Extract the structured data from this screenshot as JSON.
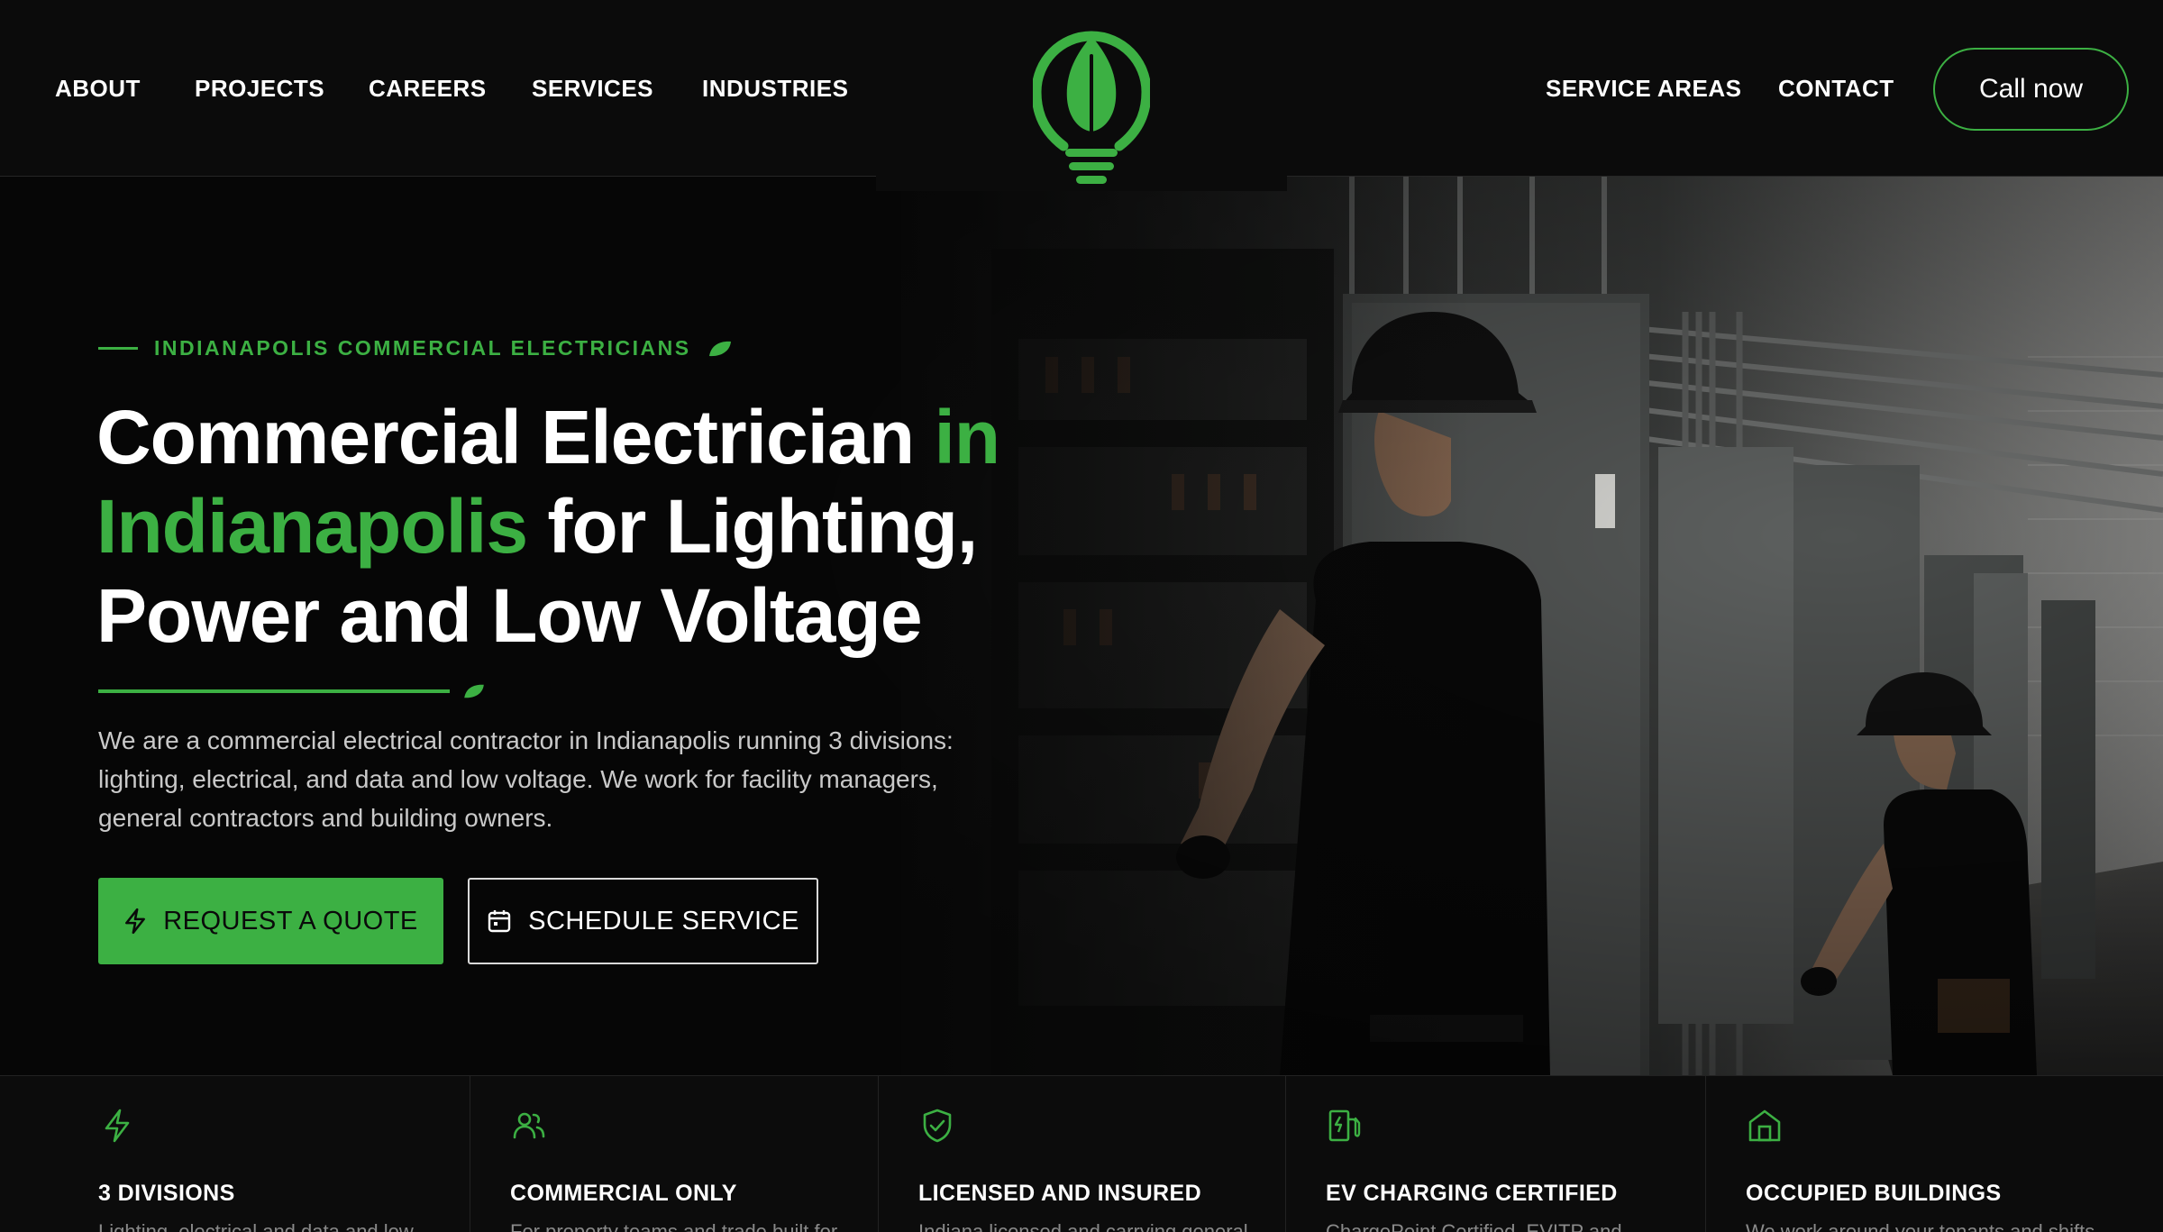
{
  "nav": {
    "left": [
      "ABOUT",
      "PROJECTS",
      "CAREERS",
      "SERVICES",
      "INDUSTRIES"
    ],
    "right": [
      "SERVICE AREAS",
      "CONTACT"
    ],
    "call_label": "Call now"
  },
  "hero": {
    "eyebrow": "INDIANAPOLIS COMMERCIAL ELECTRICIANS",
    "headline": {
      "part1": "Commercial Electrician ",
      "part2_green": "in Indianapolis",
      "part3": " for Lighting, Power and Low Voltage"
    },
    "lede": "We are a commercial electrical contractor in Indianapolis running 3 divisions: lighting, electrical, and data and low voltage. We work for facility managers, general contractors and building owners.",
    "cta_primary": "REQUEST A QUOTE",
    "cta_secondary": "SCHEDULE SERVICE"
  },
  "features": [
    {
      "icon": "lightning-icon",
      "title": "3 DIVISIONS",
      "desc": "Lighting, electrical and data and low"
    },
    {
      "icon": "users-icon",
      "title": "COMMERCIAL ONLY",
      "desc": "For property teams and trade built for"
    },
    {
      "icon": "shield-check-icon",
      "title": "LICENSED AND INSURED",
      "desc": "Indiana licensed and carrying general"
    },
    {
      "icon": "ev-charger-icon",
      "title": "EV CHARGING CERTIFIED",
      "desc": "ChargePoint Certified, EVITP and"
    },
    {
      "icon": "building-icon",
      "title": "OCCUPIED BUILDINGS",
      "desc": "We work around your tenants and shifts"
    }
  ],
  "colors": {
    "accent": "#3cb043",
    "background": "#0a0a0a",
    "text": "#ffffff",
    "muted": "#c9c9c9"
  }
}
